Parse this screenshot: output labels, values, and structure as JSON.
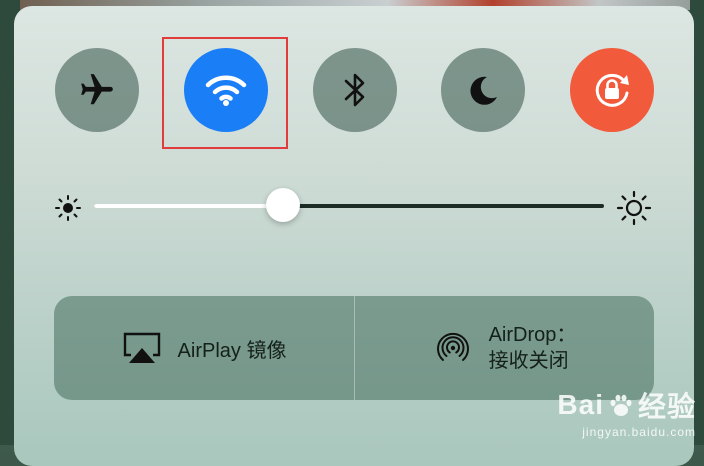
{
  "toggles": {
    "airplane": {
      "state": "off",
      "icon": "airplane-icon"
    },
    "wifi": {
      "state": "on",
      "icon": "wifi-icon",
      "color": "#1a7ff7"
    },
    "bluetooth": {
      "state": "off",
      "icon": "bluetooth-icon"
    },
    "do_not_disturb": {
      "state": "off",
      "icon": "moon-icon"
    },
    "rotation_lock": {
      "state": "on",
      "icon": "rotation-lock-icon",
      "color": "#f25a3c"
    }
  },
  "brightness": {
    "level": 0.37
  },
  "buttons": {
    "airplay_label": "AirPlay 镜像",
    "airdrop_label_line1": "AirDrop：",
    "airdrop_label_line2": "接收关闭"
  },
  "watermark": {
    "brand": "Bai",
    "brand_suffix": "经验",
    "url": "jingyan.baidu.com"
  },
  "colors": {
    "highlight": "#e23b3b"
  }
}
